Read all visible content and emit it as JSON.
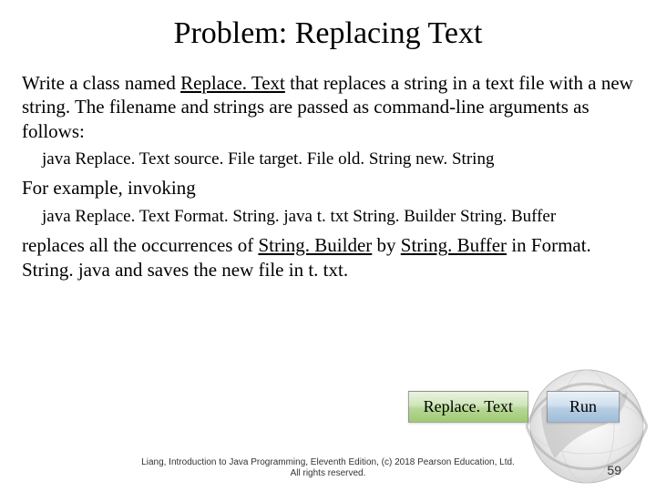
{
  "title": "Problem: Replacing Text",
  "para1": {
    "pre": "Write a class named ",
    "u": "Replace. Text",
    "post": " that replaces a string in a text file with a new string. The filename and strings are passed as command-line arguments as follows:"
  },
  "code1": "java Replace. Text source. File target. File old. String new. String",
  "para2": "For example, invoking",
  "code2": "java Replace. Text Format. String. java t. txt String. Builder String. Buffer",
  "para3": {
    "pre": "replaces all the occurrences of ",
    "u1": "String. Builder",
    "mid": " by ",
    "u2": "String. Buffer",
    "post": " in Format. String. java and saves the new file in t. txt."
  },
  "buttons": {
    "replace": "Replace. Text",
    "run": "Run"
  },
  "footer": {
    "line1": "Liang, Introduction to Java Programming, Eleventh Edition, (c) 2018 Pearson Education, Ltd.",
    "line2": "All rights reserved."
  },
  "page_number": "59"
}
